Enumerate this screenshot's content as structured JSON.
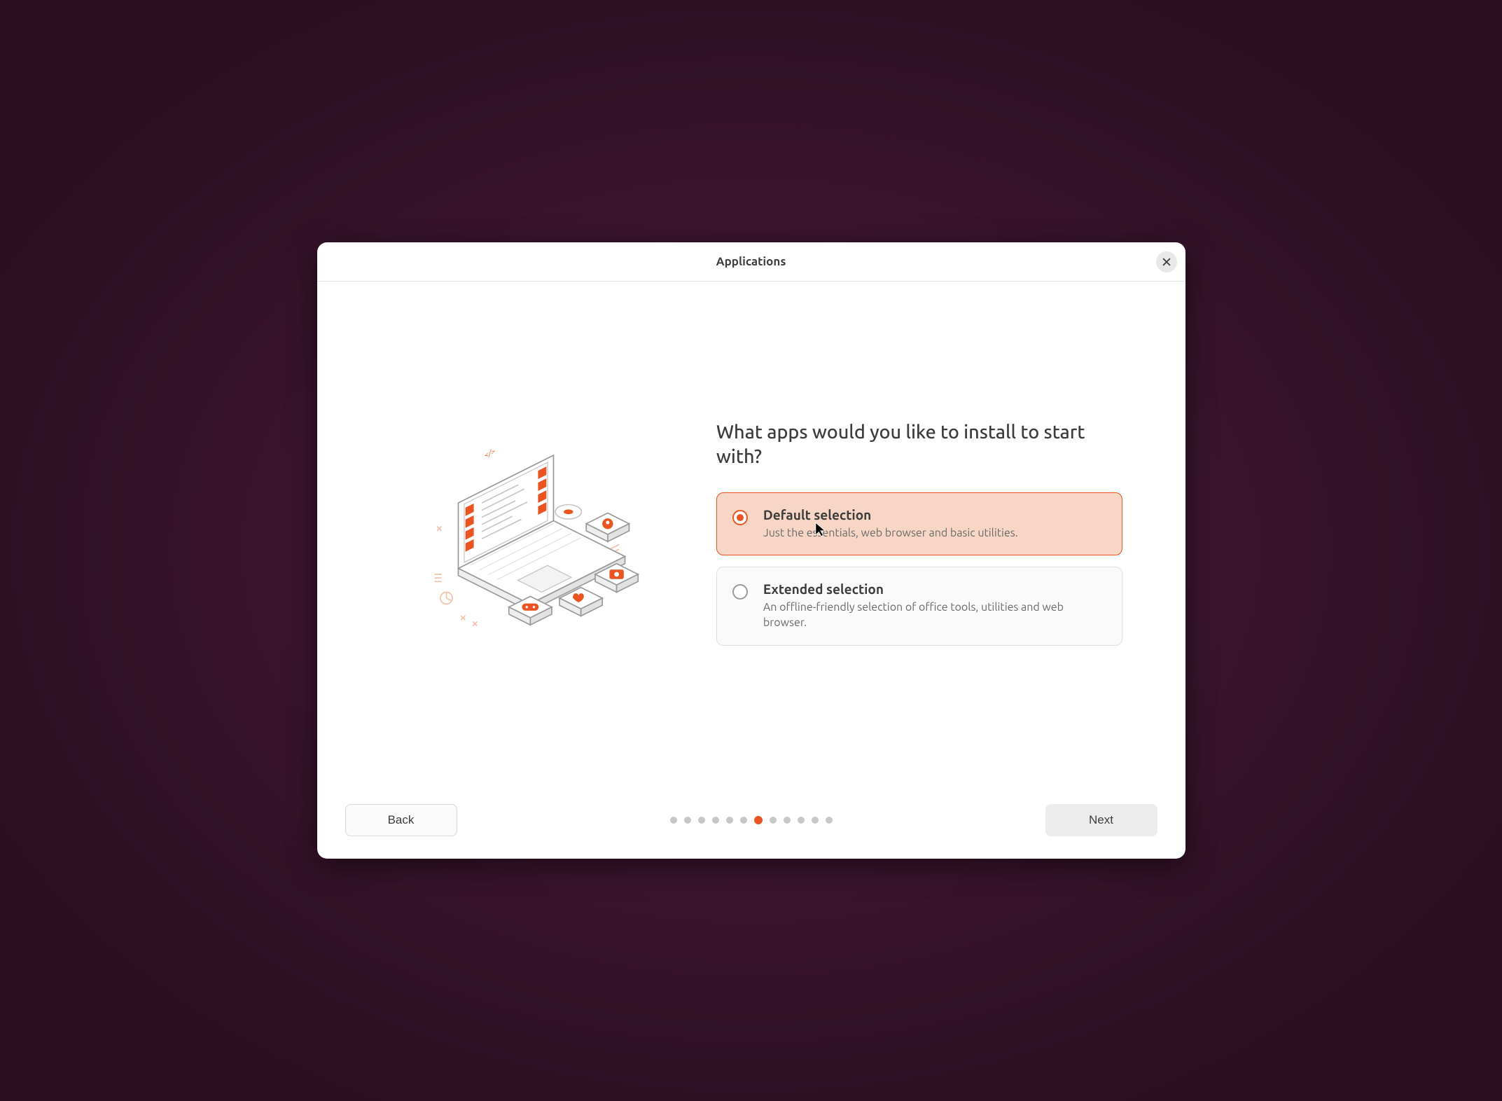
{
  "header": {
    "title": "Applications"
  },
  "main": {
    "question": "What apps would you like to install to start with?",
    "options": [
      {
        "title": "Default selection",
        "description": "Just the essentials, web browser and basic utilities.",
        "selected": true
      },
      {
        "title": "Extended selection",
        "description": "An offline-friendly selection of office tools, utilities and web browser.",
        "selected": false
      }
    ]
  },
  "footer": {
    "back_label": "Back",
    "next_label": "Next",
    "progress": {
      "total": 12,
      "current_index": 6
    }
  },
  "colors": {
    "accent": "#e95420"
  }
}
